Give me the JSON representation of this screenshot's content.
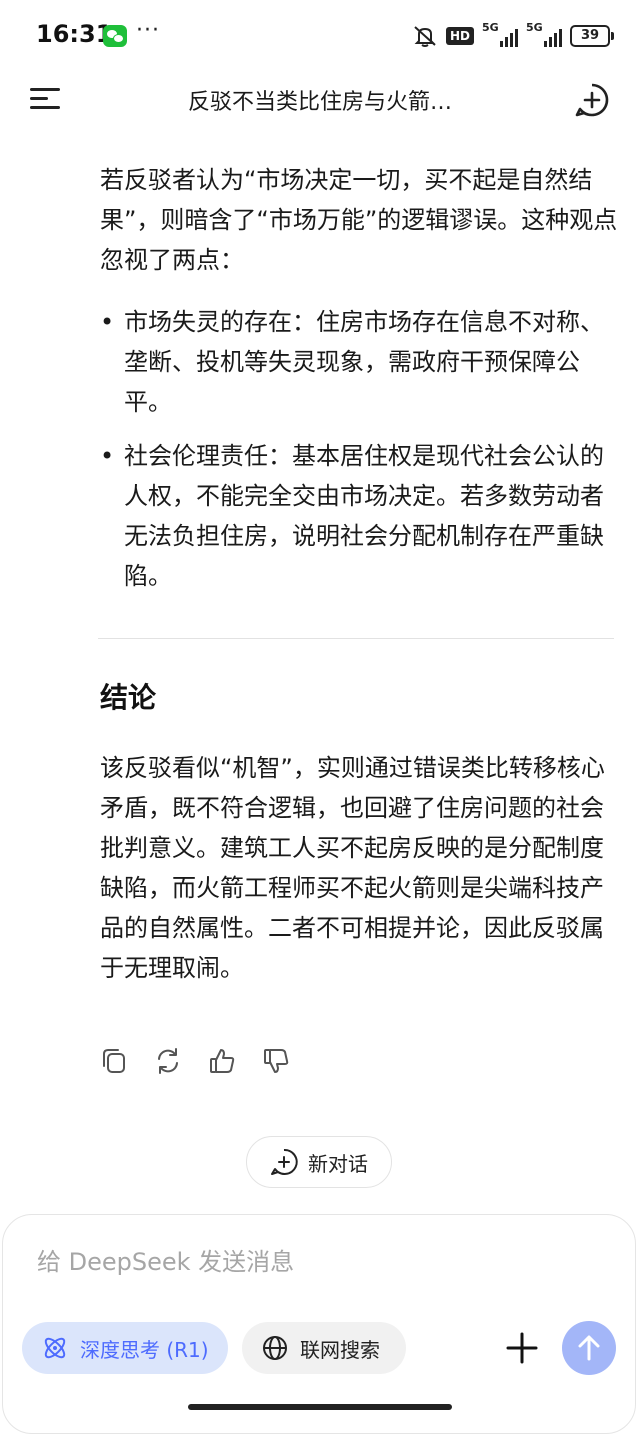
{
  "status_bar": {
    "time": "16:31",
    "more": "···",
    "hd_label": "HD",
    "signal_label_1": "5G",
    "signal_label_2": "5G",
    "battery": "39"
  },
  "header": {
    "title": "反驳不当类比住房与火箭…",
    "menu_icon": "menu-icon",
    "new_chat_icon": "new-chat-icon"
  },
  "message": {
    "intro": "若反驳者认为“市场决定一切，买不起是自然结果”，则暗含了“市场万能”的逻辑谬误。这种观点忽视了两点：",
    "bullets": [
      "市场失灵的存在：住房市场存在信息不对称、垄断、投机等失灵现象，需政府干预保障公平。",
      "社会伦理责任：基本居住权是现代社会公认的人权，不能完全交由市场决定。若多数劳动者无法负担住房，说明社会分配机制存在严重缺陷。"
    ],
    "heading": "结论",
    "conclusion": "该反驳看似“机智”，实则通过错误类比转移核心矛盾，既不符合逻辑，也回避了住房问题的社会批判意义。建筑工人买不起房反映的是分配制度缺陷，而火箭工程师买不起火箭则是尖端科技产品的自然属性。二者不可相提并论，因此反驳属于无理取闹。"
  },
  "actions": [
    "copy-icon",
    "regenerate-icon",
    "thumbs-up-icon",
    "thumbs-down-icon"
  ],
  "new_chat_pill": {
    "label": "新对话"
  },
  "composer": {
    "placeholder": "给 DeepSeek 发送消息",
    "deep_think_label": "深度思考 (R1)",
    "web_search_label": "联网搜索"
  },
  "colors": {
    "accent": "#4d6bfe",
    "chip_active_bg": "#dbe5fb",
    "send_button": "#a3b6f8"
  }
}
